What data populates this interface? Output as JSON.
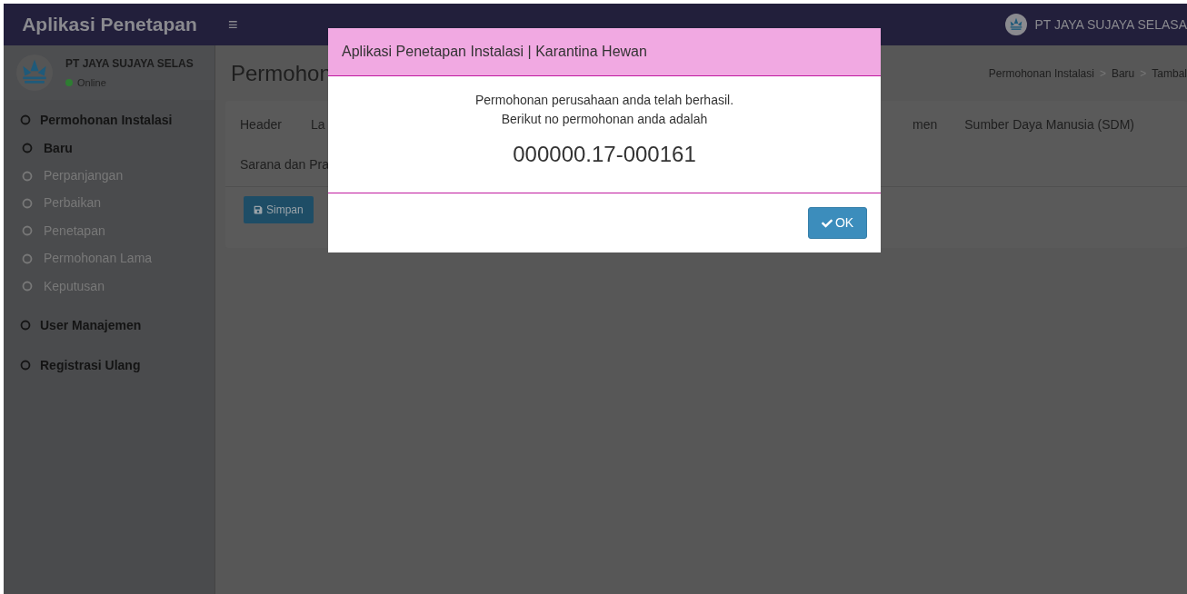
{
  "topbar": {
    "app_title": "Aplikasi Penetapan",
    "menu_glyph": "≡",
    "company": "PT JAYA SUJAYA SELASA"
  },
  "sidebar": {
    "user": {
      "name": "PT JAYA SUJAYA SELAS",
      "status": "Online",
      "color": "#2e7d32"
    },
    "items": [
      {
        "label": "Permohonan Instalasi",
        "selected": false,
        "children": [
          {
            "label": "Baru",
            "selected": true
          },
          {
            "label": "Perpanjangan",
            "selected": false
          },
          {
            "label": "Perbaikan",
            "selected": false
          },
          {
            "label": "Penetapan",
            "selected": false
          },
          {
            "label": "Permohonan Lama",
            "selected": false
          },
          {
            "label": "Keputusan",
            "selected": false
          }
        ]
      },
      {
        "label": "User Manajemen",
        "selected": false
      },
      {
        "label": "Registrasi Ulang",
        "selected": false
      }
    ]
  },
  "page": {
    "title": "Permohon",
    "breadcrumb": [
      "Permohonan Instalasi",
      "Baru",
      "Tambal"
    ],
    "breadcrumb_separator": ">",
    "tab_rows": [
      [
        "Header",
        "La",
        "men",
        "Sumber Daya Manusia (SDM)"
      ],
      [
        "Sarana dan Pra"
      ]
    ],
    "save_button": "Simpan"
  },
  "modal": {
    "title": "Aplikasi Penetapan Instalasi | Karantina Hewan",
    "message": [
      "Permohonan perusahaan anda telah berhasil.",
      "Berikut no permohonan anda adalah"
    ],
    "number": "000000.17-000161",
    "ok_button": "OK"
  }
}
